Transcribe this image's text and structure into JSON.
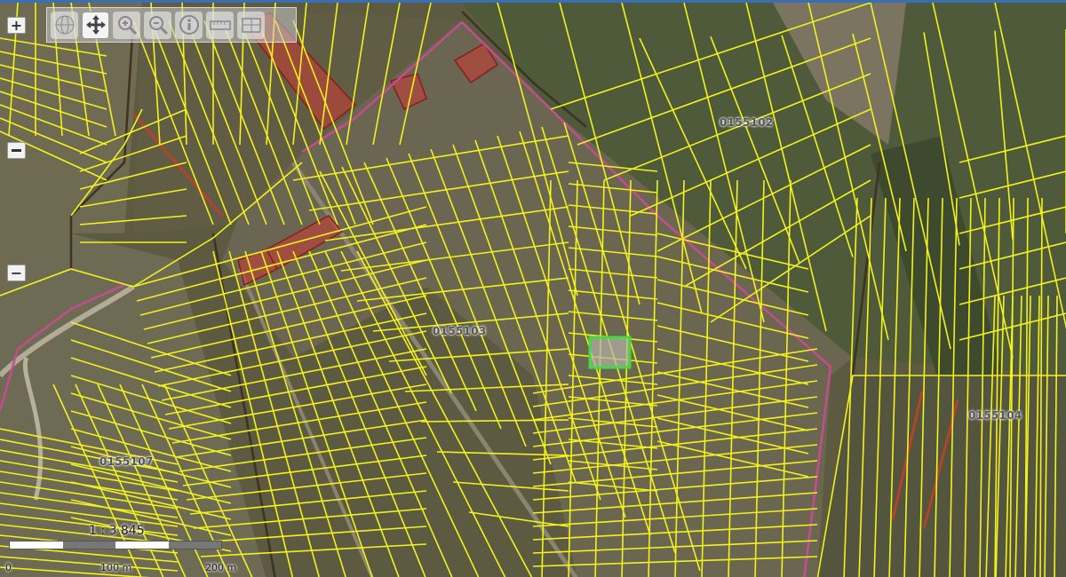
{
  "map": {
    "parcel_line_color": "#f2f21d",
    "boundary_color": "#c44d8f",
    "highlight_color": "#cc3333",
    "selected_color": "#3fdc3f",
    "labels": [
      {
        "id": "parcel-label-0155102",
        "text": "0155102"
      },
      {
        "id": "parcel-label-0155103",
        "text": "0155103"
      },
      {
        "id": "parcel-label-0155104",
        "text": "0155104"
      },
      {
        "id": "parcel-label-0155107",
        "text": "0155107"
      }
    ]
  },
  "toolbar": {
    "tools": [
      {
        "name": "globe-icon",
        "active": false
      },
      {
        "name": "pan-move-icon",
        "active": true
      },
      {
        "name": "zoom-in-icon",
        "active": false
      },
      {
        "name": "zoom-out-icon",
        "active": false
      },
      {
        "name": "info-icon",
        "active": false
      },
      {
        "name": "measure-length-icon",
        "active": false
      },
      {
        "name": "measure-area-icon",
        "active": false
      }
    ]
  },
  "zoom": {
    "plus": "+",
    "minus": "−"
  },
  "scale": {
    "ratio": "1 : 3 845",
    "ticks": [
      "0",
      "100 m",
      "200 m"
    ]
  }
}
